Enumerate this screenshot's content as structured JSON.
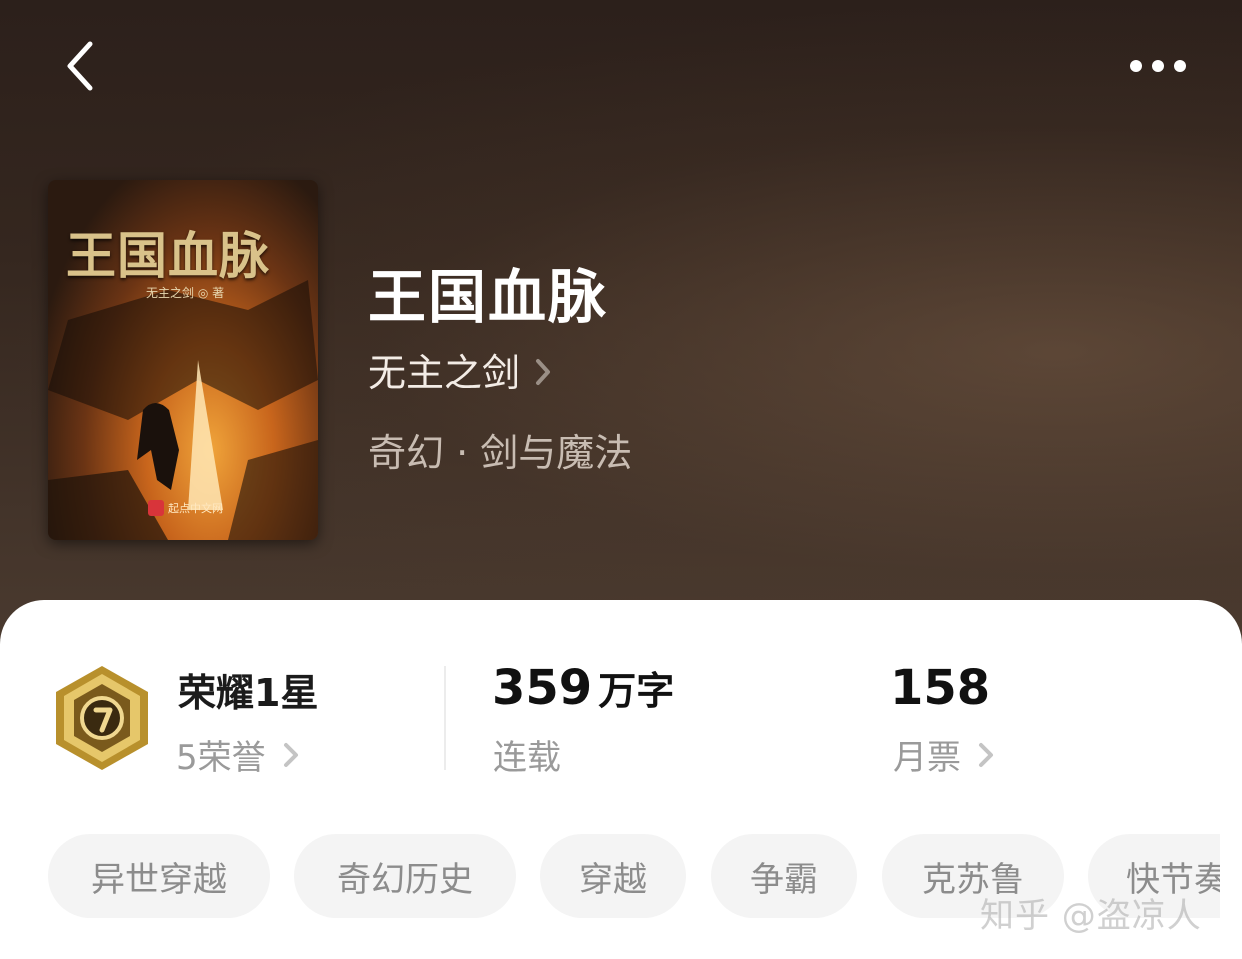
{
  "book": {
    "cover_title": "王国血脉",
    "cover_author": "无主之剑 ◎ 著",
    "cover_publisher": "起点中文网",
    "title": "王国血脉",
    "author": "无主之剑",
    "genre": "奇幻 · 剑与魔法"
  },
  "stats": {
    "honor_level": "荣耀1星",
    "honor_count": "5荣誉",
    "word_count": "359",
    "word_unit": "万字",
    "status": "连载",
    "monthly_tickets": "158",
    "monthly_tickets_label": "月票"
  },
  "tags": [
    "异世穿越",
    "奇幻历史",
    "穿越",
    "争霸",
    "克苏鲁",
    "快节奏"
  ],
  "watermark": "知乎 @盗凉人",
  "icons": [
    "back-arrow-icon",
    "more-dots-icon",
    "chevron-right-icon",
    "honor-medal-icon"
  ],
  "colors": {
    "hero_bg": "#35271f",
    "medal_gold": "#c9a23a",
    "tag_bg": "#f4f4f4"
  }
}
